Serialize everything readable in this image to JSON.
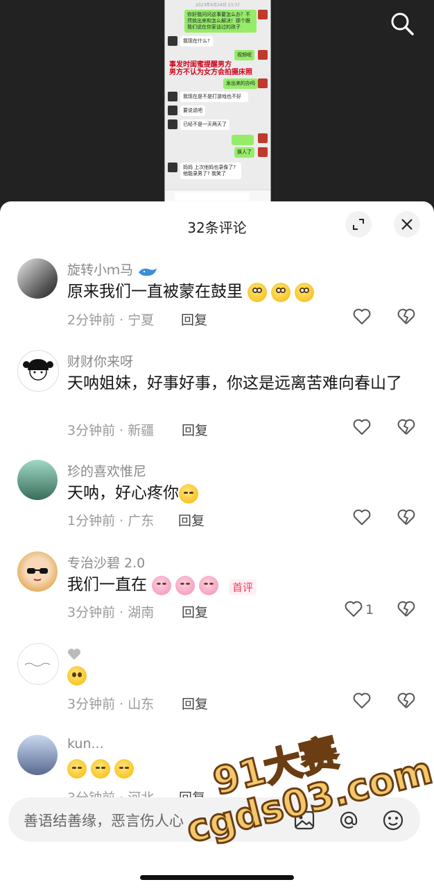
{
  "video": {
    "chat_timestamp": "2023年6月24日 23:37",
    "chat_lines": [
      "你好我问问这事要怎么办？不然就出来和怎么解决！那个跟我们说在你家谈过的孩子",
      "我现在什么?",
      "视频呢",
      "发出来的办吗",
      "我现在是不是打游戏也不好",
      "要说说吧",
      "已经不是一天两天了",
      "换人了",
      "妈妈 上次他妈也录像了? 他能录男了? 我笑了"
    ],
    "overlay_text_1": "事发时闺蜜提醒男方",
    "overlay_text_2": "男方不认为女方会拍摄床照"
  },
  "panel": {
    "title": "32条评论"
  },
  "comments": [
    {
      "user": "旋转小ｍ马",
      "text": "原来我们一直被蒙在鼓里",
      "time": "2分钟前 · 宁夏",
      "reply": "回复",
      "emojis": [
        "pleading",
        "pleading",
        "pleading"
      ],
      "likes": ""
    },
    {
      "user": "财财你来呀",
      "text": "天呐姐妹，好事好事，你这是远离苦难向春山了",
      "time": "3分钟前 · 新疆",
      "reply": "回复",
      "emojis": [],
      "likes": ""
    },
    {
      "user": "珍的喜欢惟尼",
      "text": "天呐，好心疼你",
      "time": "1分钟前 · 广东",
      "reply": "回复",
      "emojis": [
        "cry"
      ],
      "likes": ""
    },
    {
      "user": "专治沙碧 2.0",
      "text": "我们一直在",
      "time": "3分钟前 · 湖南",
      "reply": "回复",
      "emojis": [
        "hug",
        "hug",
        "hug"
      ],
      "likes": "1",
      "badge": "首评"
    },
    {
      "user": "",
      "text": "",
      "time": "3分钟前 · 山东",
      "reply": "回复",
      "emojis": [
        "flush"
      ],
      "likes": ""
    },
    {
      "user": "kun...",
      "text": "",
      "time": "3分钟前 · 河北",
      "reply": "回复",
      "emojis": [
        "cry",
        "cry",
        "cry"
      ],
      "likes": ""
    }
  ],
  "bottom": {
    "placeholder": "善语结善缘，恶言伤人心"
  },
  "watermark": {
    "line1": "91大赛",
    "line2": "cgds03.com"
  },
  "colors": {
    "accent": "#f03a5f",
    "badge_bg": "#fff0f3"
  }
}
